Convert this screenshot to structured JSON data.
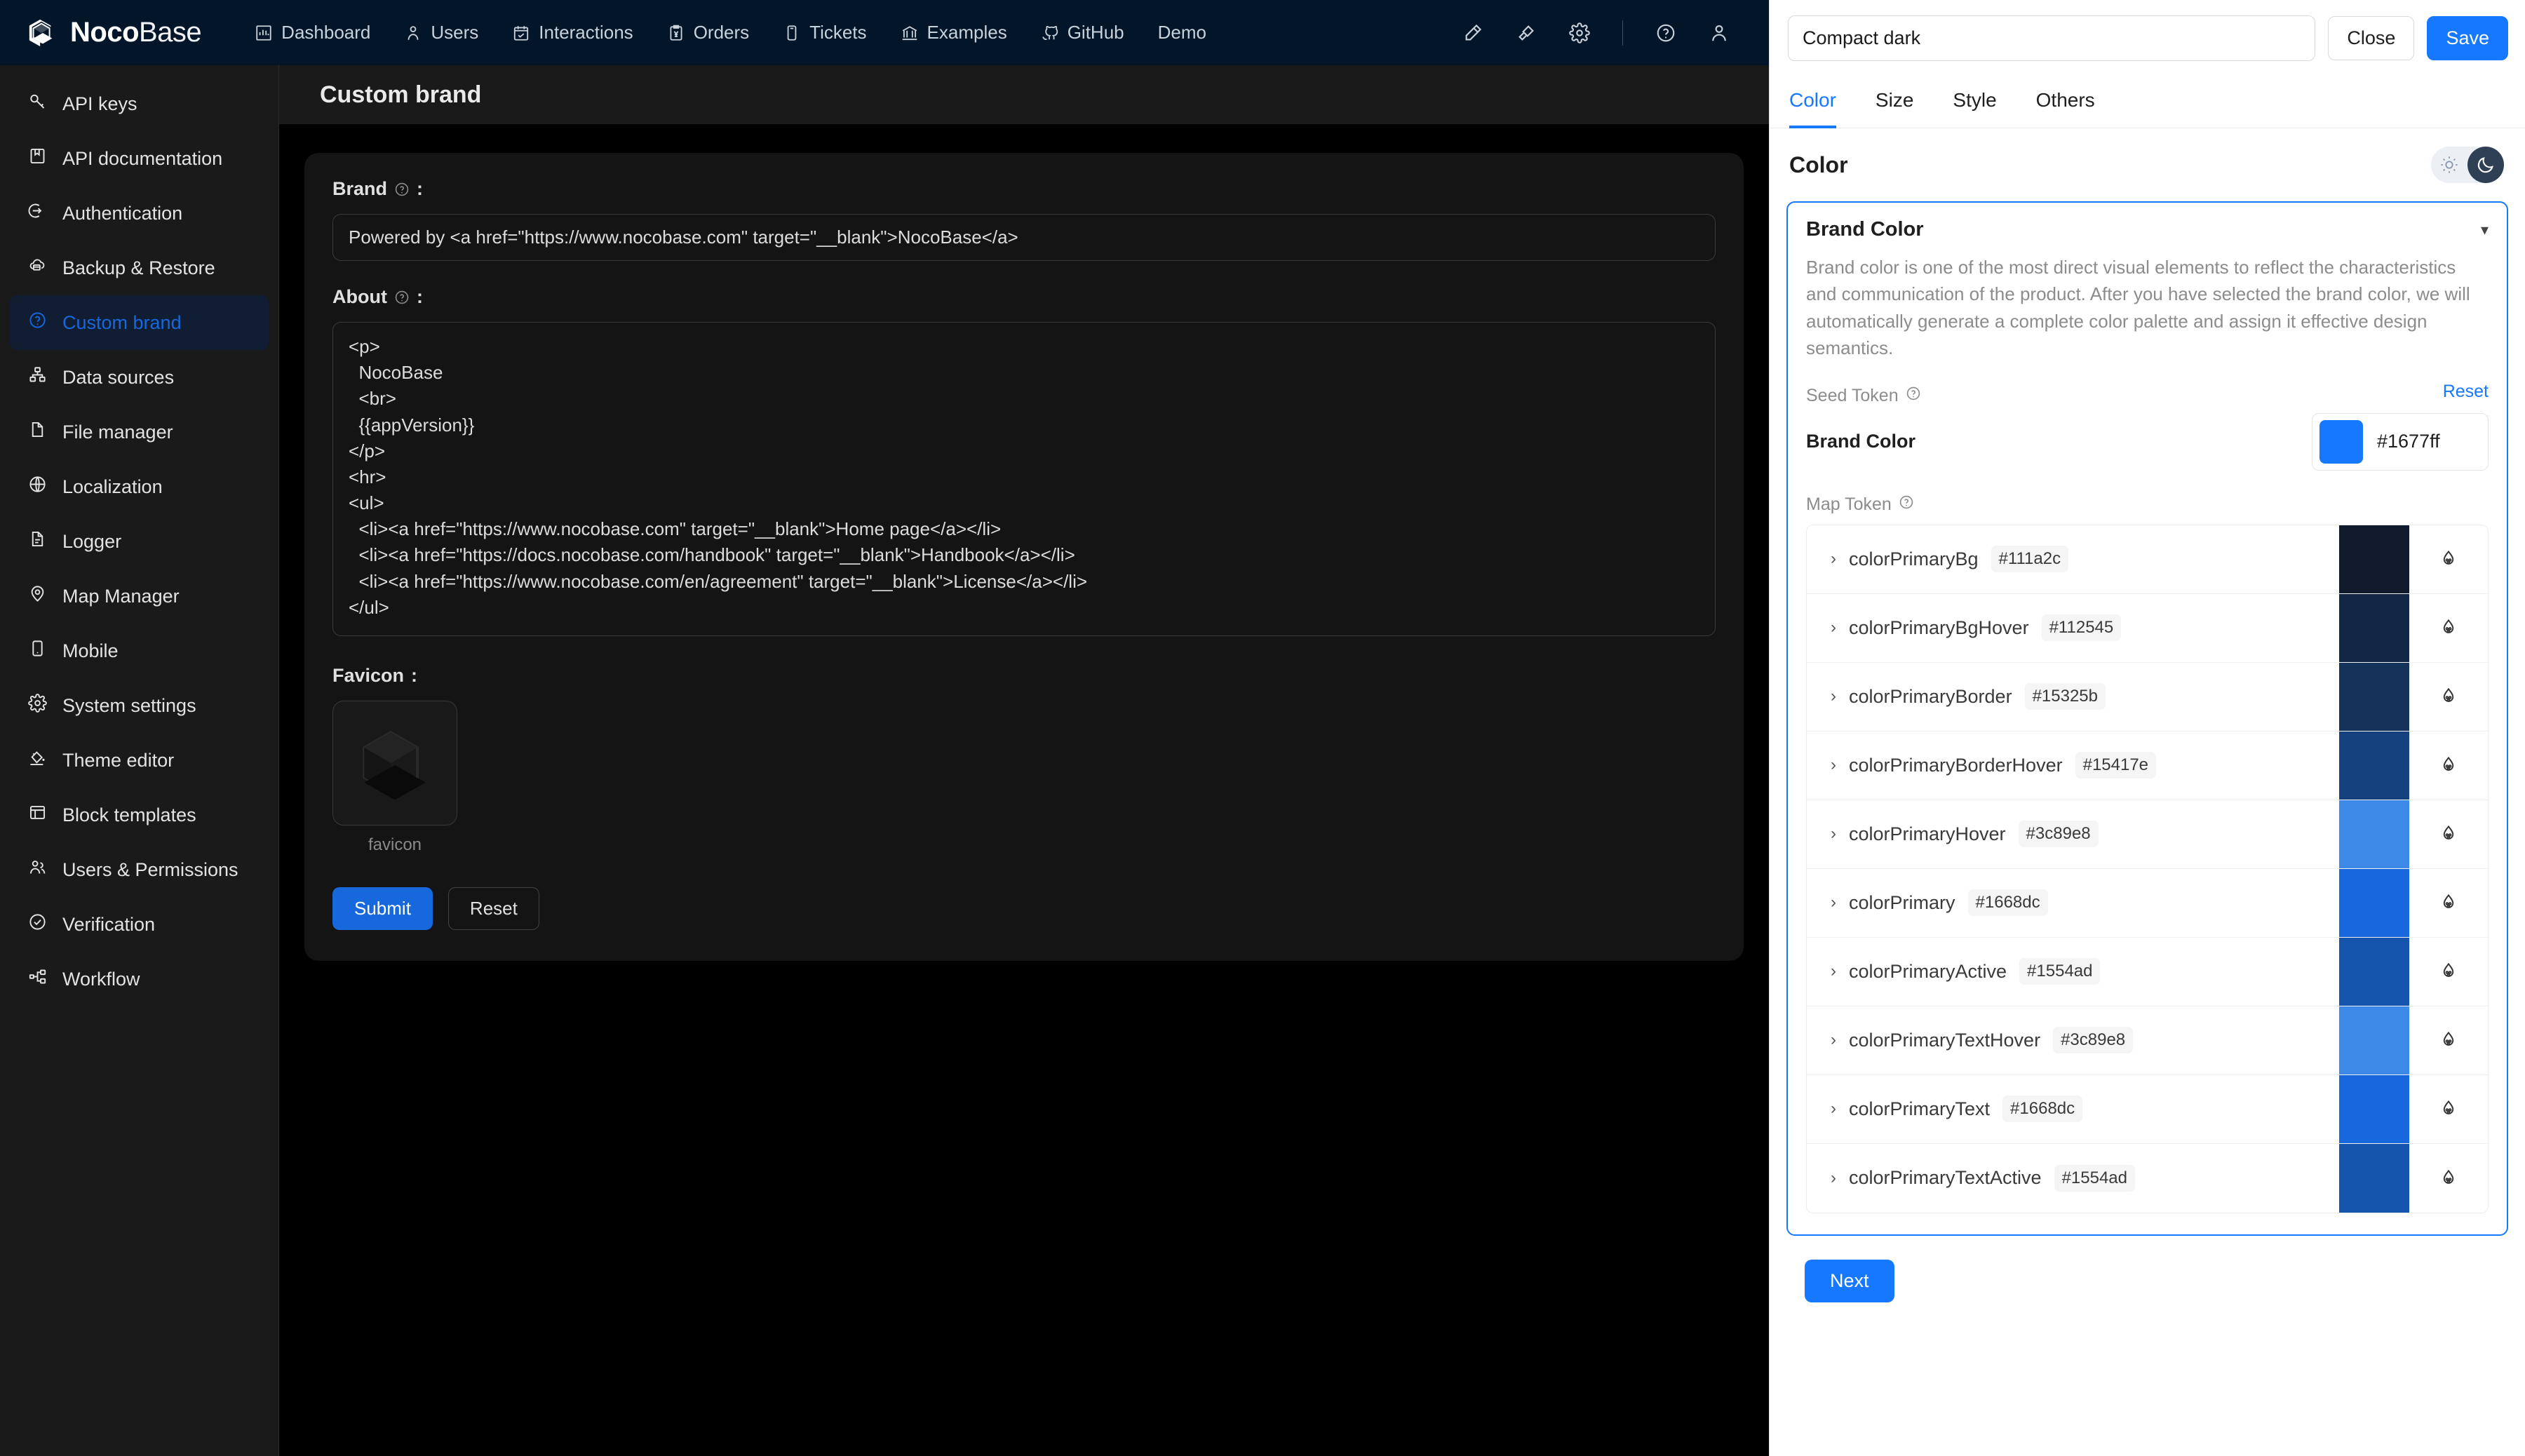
{
  "topnav": {
    "logo_bold": "Noco",
    "logo_light": "Base",
    "items": [
      {
        "label": "Dashboard",
        "icon": "bar-chart-icon"
      },
      {
        "label": "Users",
        "icon": "user-icon"
      },
      {
        "label": "Interactions",
        "icon": "calendar-check-icon"
      },
      {
        "label": "Orders",
        "icon": "yen-clipboard-icon"
      },
      {
        "label": "Tickets",
        "icon": "ticket-icon"
      },
      {
        "label": "Examples",
        "icon": "bank-icon"
      },
      {
        "label": "GitHub",
        "icon": "github-icon"
      },
      {
        "label": "Demo",
        "icon": "none"
      }
    ],
    "right_icons": [
      "highlighter-icon",
      "plugin-icon",
      "gear-icon",
      "help-circle-icon",
      "avatar-icon"
    ]
  },
  "sidebar": {
    "items": [
      {
        "label": "API keys",
        "icon": "key-icon",
        "active": false
      },
      {
        "label": "API documentation",
        "icon": "book-icon",
        "active": false
      },
      {
        "label": "Authentication",
        "icon": "login-icon",
        "active": false
      },
      {
        "label": "Backup & Restore",
        "icon": "cloud-backup-icon",
        "active": false
      },
      {
        "label": "Custom brand",
        "icon": "question-circle-icon",
        "active": true
      },
      {
        "label": "Data sources",
        "icon": "sitemap-icon",
        "active": false
      },
      {
        "label": "File manager",
        "icon": "file-icon",
        "active": false
      },
      {
        "label": "Localization",
        "icon": "globe-icon",
        "active": false
      },
      {
        "label": "Logger",
        "icon": "file-text-icon",
        "active": false
      },
      {
        "label": "Map Manager",
        "icon": "map-pin-icon",
        "active": false
      },
      {
        "label": "Mobile",
        "icon": "mobile-icon",
        "active": false
      },
      {
        "label": "System settings",
        "icon": "gear-icon",
        "active": false
      },
      {
        "label": "Theme editor",
        "icon": "paint-bucket-icon",
        "active": false
      },
      {
        "label": "Block templates",
        "icon": "layout-icon",
        "active": false
      },
      {
        "label": "Users & Permissions",
        "icon": "users-icon",
        "active": false
      },
      {
        "label": "Verification",
        "icon": "check-circle-icon",
        "active": false
      },
      {
        "label": "Workflow",
        "icon": "workflow-icon",
        "active": false
      }
    ]
  },
  "page": {
    "title": "Custom brand",
    "brand_label": "Brand",
    "brand_label_suffix": ":",
    "brand_value": "Powered by <a href=\"https://www.nocobase.com\" target=\"__blank\">NocoBase</a>",
    "about_label": "About",
    "about_label_suffix": ":",
    "about_value": "<p>\n  NocoBase\n  <br>\n  {{appVersion}}\n</p>\n<hr>\n<ul>\n  <li><a href=\"https://www.nocobase.com\" target=\"__blank\">Home page</a></li>\n  <li><a href=\"https://docs.nocobase.com/handbook\" target=\"__blank\">Handbook</a></li>\n  <li><a href=\"https://www.nocobase.com/en/agreement\" target=\"__blank\">License</a></li>\n</ul>",
    "favicon_label": "Favicon",
    "favicon_label_suffix": ":",
    "favicon_name": "favicon",
    "submit_label": "Submit",
    "reset_label": "Reset"
  },
  "panel": {
    "theme_name": "Compact dark",
    "close_label": "Close",
    "save_label": "Save",
    "tabs": [
      {
        "label": "Color",
        "active": true
      },
      {
        "label": "Size",
        "active": false
      },
      {
        "label": "Style",
        "active": false
      },
      {
        "label": "Others",
        "active": false
      }
    ],
    "section_heading": "Color",
    "theme_mode": "dark",
    "brand_section": {
      "title": "Brand Color",
      "description": "Brand color is one of the most direct visual elements to reflect the characteristics and communication of the product. After you have selected the brand color, we will automatically generate a complete color palette and assign it effective design semantics.",
      "reset_label": "Reset",
      "seed_token_label": "Seed Token",
      "seed_name": "Brand Color",
      "seed_value": "#1677ff",
      "map_token_label": "Map Token",
      "tokens": [
        {
          "name": "colorPrimaryBg",
          "hex": "#111a2c"
        },
        {
          "name": "colorPrimaryBgHover",
          "hex": "#112545"
        },
        {
          "name": "colorPrimaryBorder",
          "hex": "#15325b"
        },
        {
          "name": "colorPrimaryBorderHover",
          "hex": "#15417e"
        },
        {
          "name": "colorPrimaryHover",
          "hex": "#3c89e8"
        },
        {
          "name": "colorPrimary",
          "hex": "#1668dc"
        },
        {
          "name": "colorPrimaryActive",
          "hex": "#1554ad"
        },
        {
          "name": "colorPrimaryTextHover",
          "hex": "#3c89e8"
        },
        {
          "name": "colorPrimaryText",
          "hex": "#1668dc"
        },
        {
          "name": "colorPrimaryTextActive",
          "hex": "#1554ad"
        }
      ]
    },
    "next_label": "Next"
  },
  "colors": {
    "accent": "#1677ff",
    "accent_dark_app": "#1668dc",
    "topnav_bg": "#021529",
    "sidebar_bg": "#1a1a1a",
    "panel_bg": "#ffffff"
  }
}
